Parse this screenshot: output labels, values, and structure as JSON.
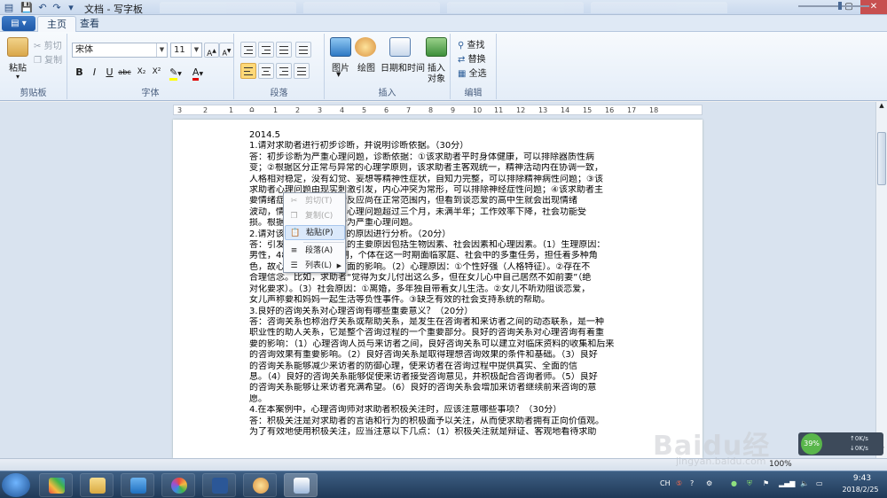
{
  "window": {
    "title": "文档 - 写字板"
  },
  "tabs": [
    {
      "label": "主页",
      "active": true
    },
    {
      "label": "查看",
      "active": false
    }
  ],
  "clipboard": {
    "paste": "粘贴",
    "cut": "剪切",
    "copy": "复制",
    "label": "剪贴板"
  },
  "font": {
    "name": "宋体",
    "size": "11",
    "label": "字体",
    "bold": "B",
    "italic": "I",
    "underline": "U",
    "strike": "abc",
    "sub": "X₂",
    "sup": "X²"
  },
  "paragraph": {
    "label": "段落"
  },
  "insert": {
    "picture": "图片",
    "paint": "绘图",
    "datetime": "日期和时间",
    "object_line1": "插入",
    "object_line2": "对象",
    "label": "插入"
  },
  "editing": {
    "find": "查找",
    "replace": "替换",
    "select_all": "全选",
    "label": "编辑"
  },
  "ruler": {
    "ticks": [
      "3",
      "2",
      "1",
      "1",
      "2",
      "3",
      "4",
      "5",
      "6",
      "7",
      "8",
      "9",
      "10",
      "11",
      "12",
      "13",
      "14",
      "15",
      "16",
      "17",
      "18"
    ]
  },
  "document": {
    "lines": [
      "2014.5",
      "1.请对求助者进行初步诊断，并说明诊断依据。（30分）",
      "答：初步诊断为严重心理问题，诊断依据：①该求助者平时身体健康，可以排除器质性病",
      "变；②根据区分正常与异常的心理学原则，该求助者主客观统一，精神活动内在协调一致，",
      "人格相对稳定，没有幻觉、妄想等精神性症状，自知力完整，可以排除精神病性问题；③该",
      "求助者心理问题由现实刺激引发，内心冲突为常形，可以排除神经症性问题；④该求助者主",
      "要情绪症状为焦虑，情绪反应尚在正常范围内，但看到谈恋爱的高中生就会出现情绪",
      "波动，情绪反应已泛化，心理问题超过三个月，未满半年；工作效率下降，社会功能受",
      "损。根据以上症状，诊断为严重心理问题。",
      "2.请对该求助者心理问题的原因进行分析。（20分）",
      "答：引发求助者心理问题的主要原因包括生物因素、社会因素和心理因素。（1）生理原因：",
      "男性，48岁，处于中年期，个体在这一时期面临家庭、社会中的多重任务，担任着多种角",
      "色，故心理容易受到多方面的影响。（2）心理原因：①个性好强（人格特征）。②存在不",
      "合理信念。比如，求助者“觉得为女儿付出这么多，但在女儿心中自己居然不如前妻”（绝",
      "对化要求）。（3）社会原因：①离婚，多年独自带着女儿生活。②女儿不听劝阻谈恋爱，",
      "女儿声称要和妈妈一起生活等负性事件。③缺乏有效的社会支持系统的帮助。",
      "3.良好的咨询关系对心理咨询有哪些重要意义？（20分）",
      "答：咨询关系也称治疗关系或帮助关系，是发生在咨询者和来访者之间的动态联系，是一种",
      "职业性的助人关系，它是整个咨询过程的一个重要部分。良好的咨询关系对心理咨询有着重",
      "要的影响：（1）心理咨询人员与来访者之间，良好咨询关系可以建立对临床资料的收集和后来",
      "的咨询效果有重要影响。（2）良好咨询关系是取得理想咨询效果的条件和基础。（3）良好",
      "的咨询关系能够减少来访者的防御心理，使来访者在咨询过程中提供真实、全面的信",
      "息。（4）良好的咨询关系能够促使来访者接受咨询意见，并积极配合咨询者师。（5）良好",
      "的咨询关系能够让来访者充满希望。（6）良好的咨询关系会增加来访者继续前来咨询的意",
      "愿。",
      "4.在本案例中，心理咨询师对求助者积极关注时，应该注意哪些事项？（30分）",
      "答：积极关注是对求助者的言语和行为的积极面予以关注，从而使求助者拥有正向价值观。",
      "为了有效地使用积极关注，应当注意以下几点：（1）积极关注就是辩证、客观地看待求助"
    ]
  },
  "context_menu": {
    "items": [
      {
        "label": "剪切(T)",
        "enabled": false,
        "icon": "scissors-icon"
      },
      {
        "label": "复制(C)",
        "enabled": false,
        "icon": "copy-icon"
      },
      {
        "label": "粘贴(P)",
        "enabled": true,
        "highlighted": true,
        "icon": "paste-icon"
      },
      {
        "label": "段落(A)",
        "enabled": true,
        "icon": "paragraph-icon"
      },
      {
        "label": "列表(L)",
        "enabled": true,
        "icon": "list-icon",
        "submenu": true
      }
    ]
  },
  "status": {
    "zoom": "100%"
  },
  "network": {
    "up": "0K/s",
    "down": "0K/s",
    "percent": "39%"
  },
  "tray": {
    "lang": "CH"
  },
  "clock": {
    "time": "9:43",
    "date": "2018/2/25"
  },
  "watermark": {
    "brand": "Baidu经验",
    "url": "jingyan.baidu.com"
  },
  "colors": {
    "accent": "#2b5797",
    "highlight": "#ffd877",
    "menu_hover": "#dbe9fb"
  }
}
